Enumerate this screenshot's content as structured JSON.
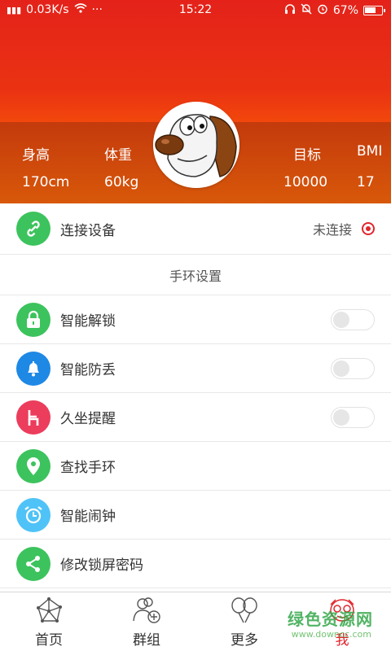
{
  "status_bar": {
    "network": "0.03K/s",
    "dots": "···",
    "time": "15:22",
    "battery": "67%",
    "battery_level": 0.67
  },
  "profile": {
    "stats": [
      {
        "label": "身高",
        "value": "170cm"
      },
      {
        "label": "体重",
        "value": "60kg"
      },
      {
        "label": "目标",
        "value": "10000"
      },
      {
        "label": "BMI",
        "value": "17"
      }
    ]
  },
  "connect": {
    "label": "连接设备",
    "status": "未连接",
    "icon": "link-icon",
    "icon_color": "#3cc35d"
  },
  "section_title": "手环设置",
  "toggle_items": [
    {
      "label": "智能解锁",
      "icon": "lock-icon",
      "color": "#3cc35d",
      "enabled": false
    },
    {
      "label": "智能防丢",
      "icon": "bell-icon",
      "color": "#1e88e5",
      "enabled": false
    },
    {
      "label": "久坐提醒",
      "icon": "chair-icon",
      "color": "#ec3d5c",
      "enabled": false
    }
  ],
  "menu_items": [
    {
      "label": "查找手环",
      "icon": "location-pin-icon",
      "color": "#3cc35d"
    },
    {
      "label": "智能闹钟",
      "icon": "alarm-clock-icon",
      "color": "#4fc3f7"
    },
    {
      "label": "修改锁屏密码",
      "icon": "share-icon",
      "color": "#3cc35d"
    }
  ],
  "bottom_nav": [
    {
      "label": "首页",
      "icon": "network-icon"
    },
    {
      "label": "群组",
      "icon": "group-add-icon"
    },
    {
      "label": "更多",
      "icon": "balloons-icon"
    },
    {
      "label": "我",
      "icon": "avatar-face-icon",
      "active": true
    }
  ],
  "watermark": {
    "text": "绿色资源网",
    "url": "www.downcc.com"
  },
  "colors": {
    "accent": "#e0262d",
    "header_top": "#e4221a",
    "header_band": "#d24c0b"
  }
}
